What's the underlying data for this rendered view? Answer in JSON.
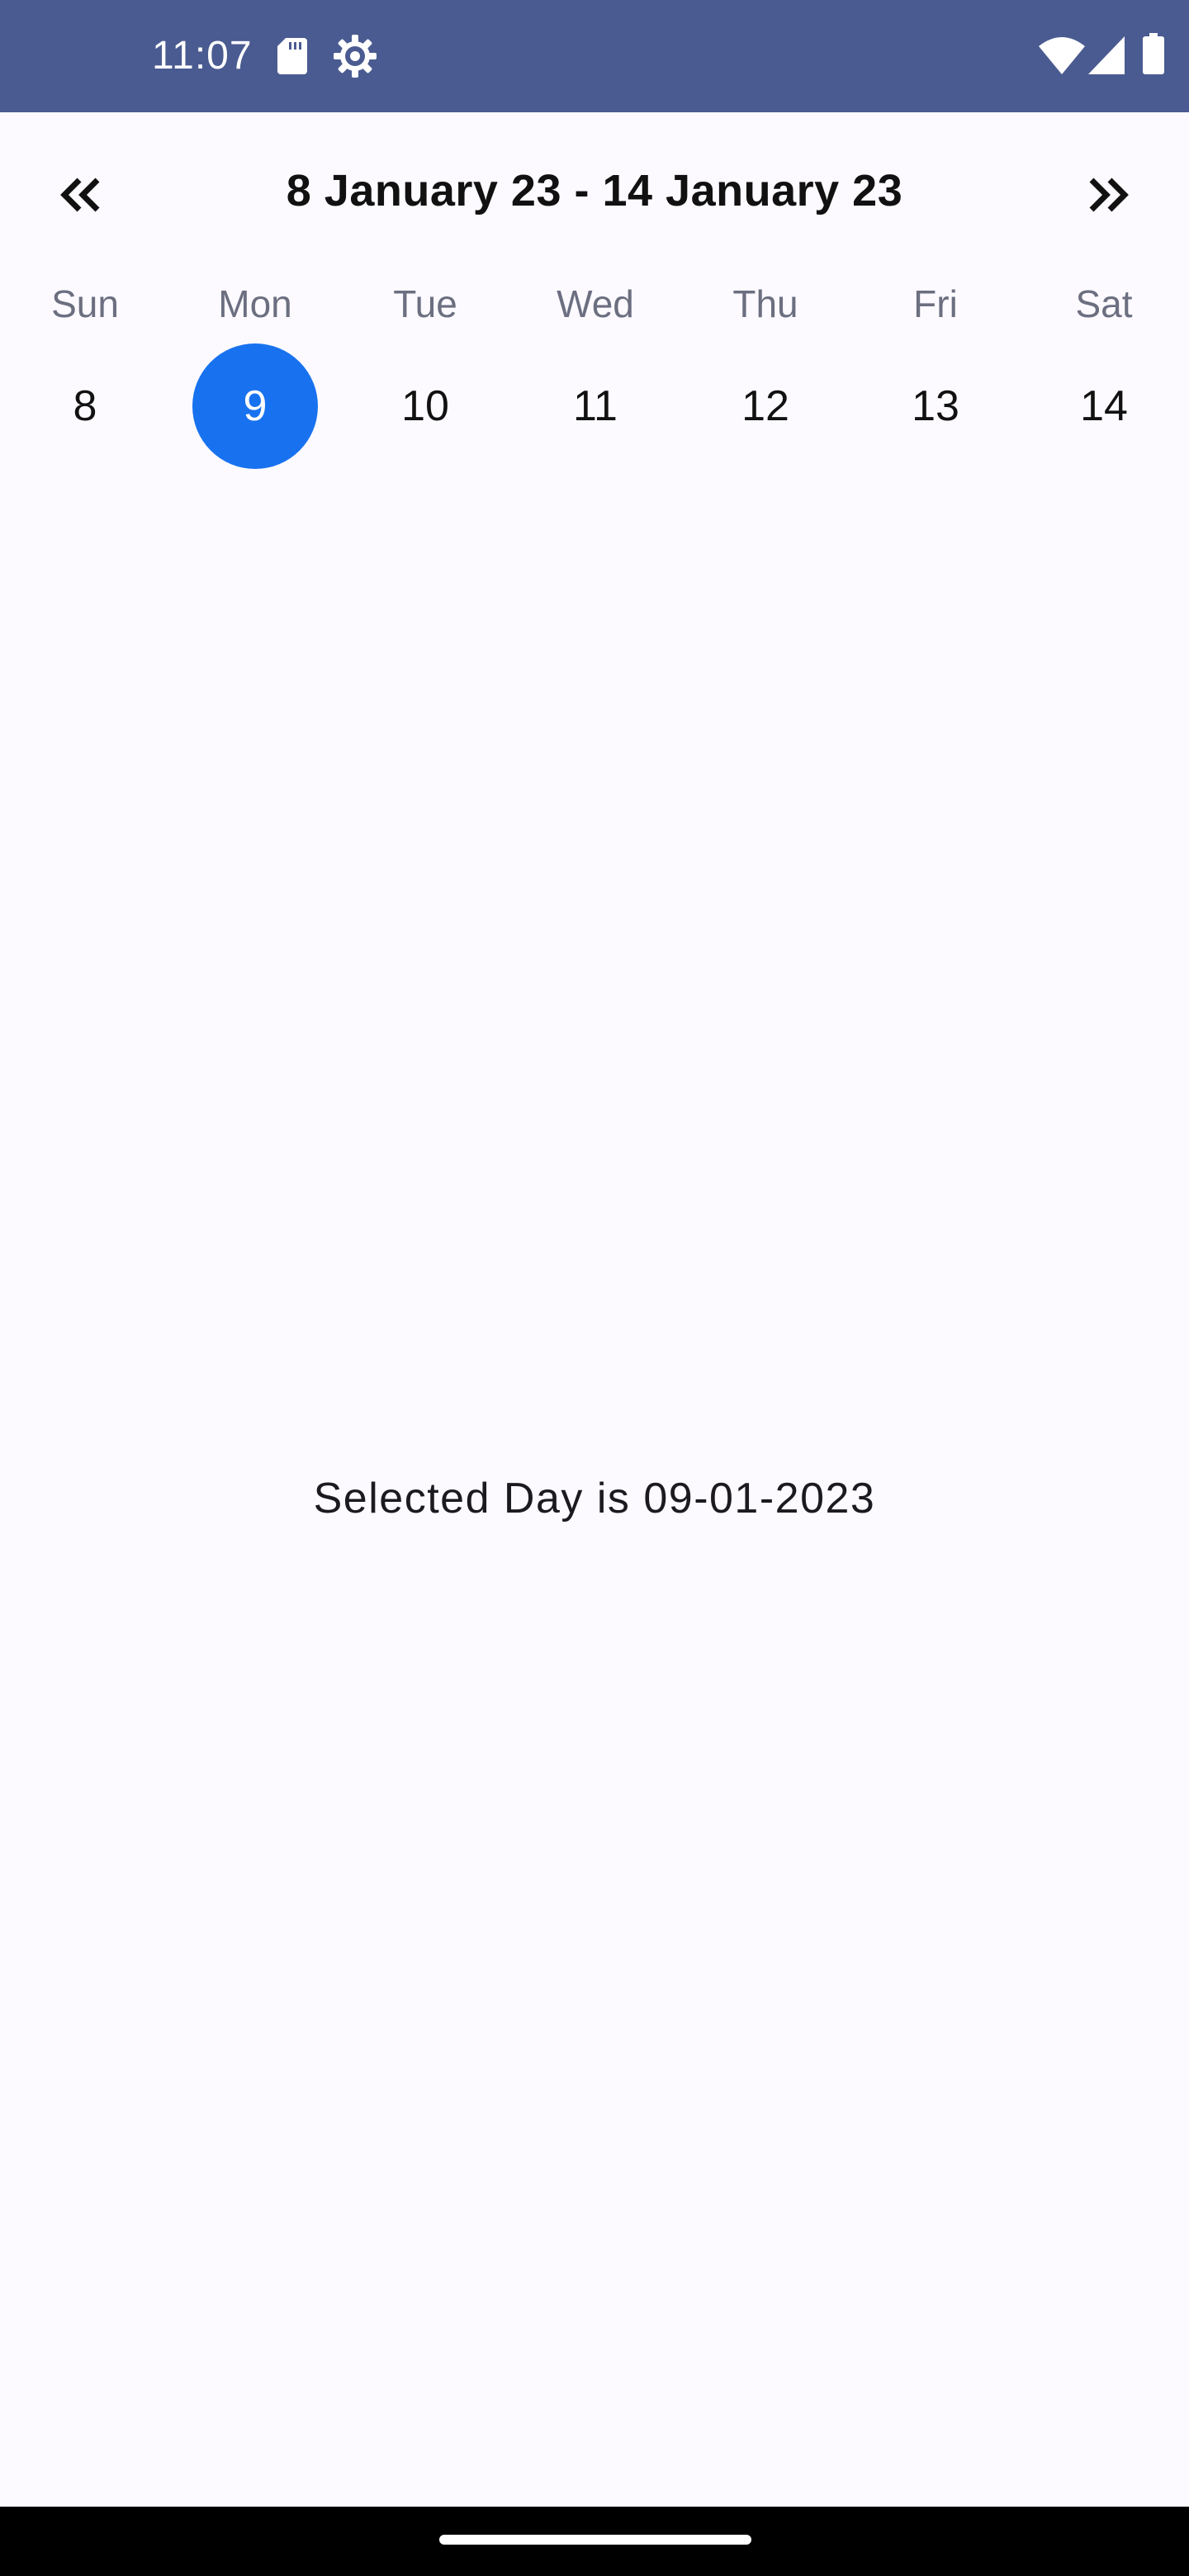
{
  "status_bar": {
    "time": "11:07",
    "background": "#4a5b91",
    "icons": [
      "sd-card-icon",
      "settings-gear-icon",
      "wifi-icon",
      "cell-signal-icon",
      "battery-icon"
    ]
  },
  "calendar": {
    "prev_icon": "double-chevron-left-icon",
    "next_icon": "double-chevron-right-icon",
    "range_title": "8 January 23 - 14 January 23",
    "selected_color": "#1872ef",
    "days": [
      {
        "name": "Sun",
        "number": "8",
        "selected": false
      },
      {
        "name": "Mon",
        "number": "9",
        "selected": true
      },
      {
        "name": "Tue",
        "number": "10",
        "selected": false
      },
      {
        "name": "Wed",
        "number": "11",
        "selected": false
      },
      {
        "name": "Thu",
        "number": "12",
        "selected": false
      },
      {
        "name": "Fri",
        "number": "13",
        "selected": false
      },
      {
        "name": "Sat",
        "number": "14",
        "selected": false
      }
    ]
  },
  "main": {
    "selected_text": "Selected Day is 09-01-2023"
  }
}
